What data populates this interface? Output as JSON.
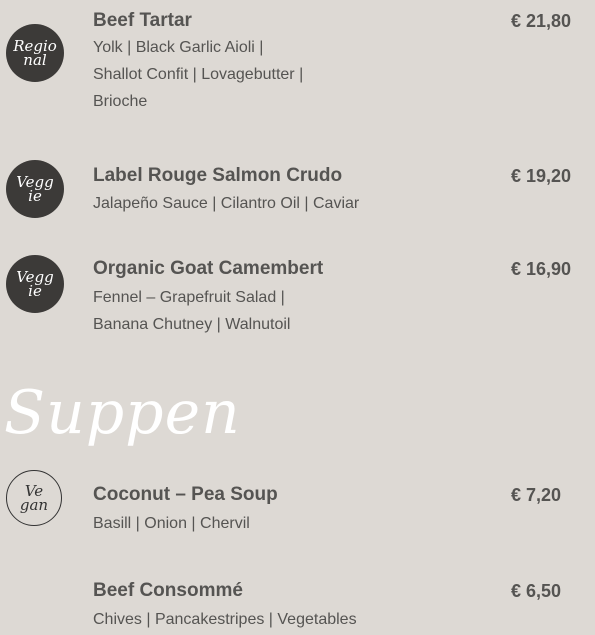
{
  "items": [
    {
      "badge": [
        "Regio",
        "nal"
      ],
      "name": "Beef Tartar",
      "price": "€ 21,80",
      "desc": [
        "Yolk | Black Garlic Aioli |",
        "Shallot Confit | Lovagebutter |",
        "Brioche"
      ]
    },
    {
      "badge": [
        "Vegg",
        "ie"
      ],
      "name": "Label Rouge Salmon Crudo",
      "price": "€ 19,20",
      "desc": [
        "Jalapeño Sauce | Cilantro Oil | Caviar"
      ]
    },
    {
      "badge": [
        "Vegg",
        "ie"
      ],
      "name": "Organic Goat Camembert",
      "price": "€ 16,90",
      "desc": [
        "Fennel – Grapefruit Salad |",
        "Banana Chutney | Walnutoil"
      ]
    }
  ],
  "section": {
    "title": "Suppen"
  },
  "soups": [
    {
      "badge": [
        "Ve",
        "gan"
      ],
      "name": "Coconut – Pea Soup",
      "price": "€ 7,20",
      "desc": [
        "Basill | Onion | Chervil"
      ]
    },
    {
      "name": "Beef Consommé",
      "price": "€ 6,50",
      "desc": [
        "Chives | Pancakestripes | Vegetables"
      ]
    }
  ]
}
